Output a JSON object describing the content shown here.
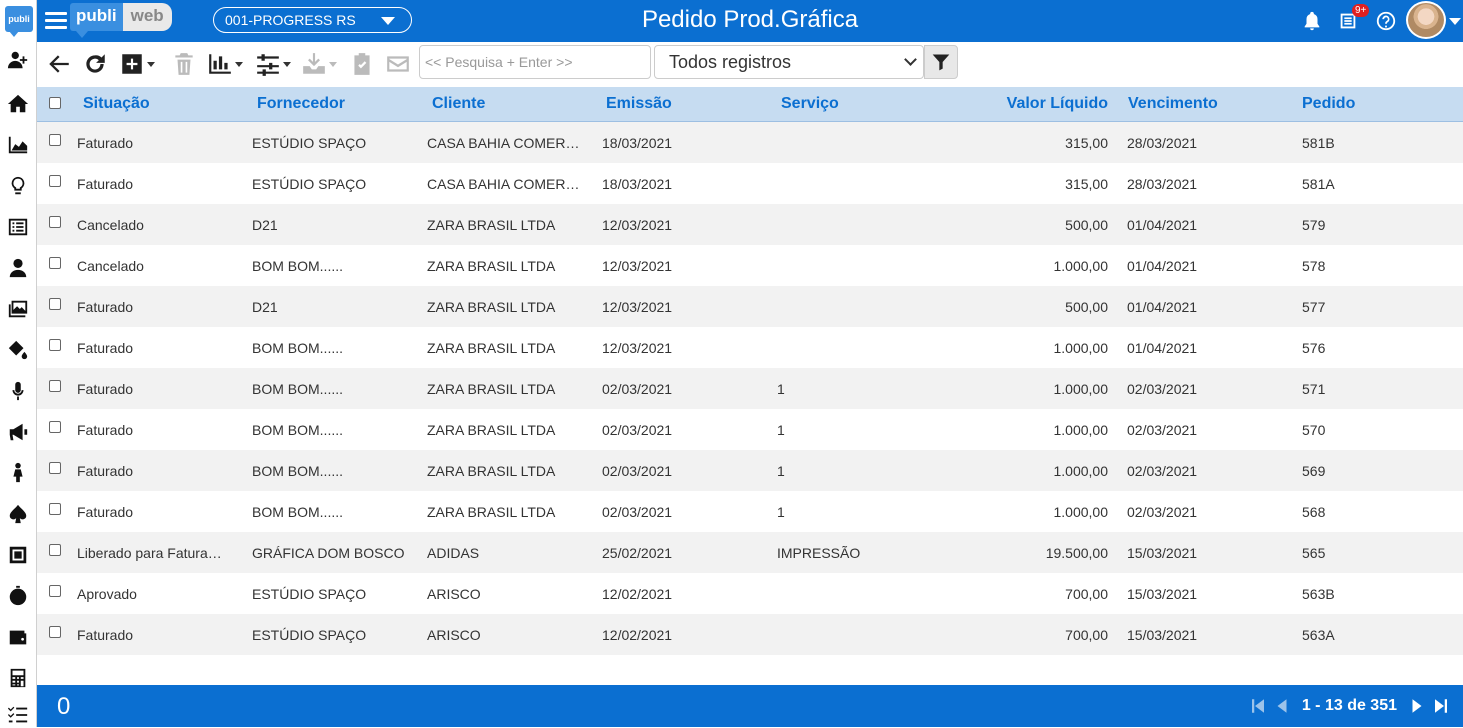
{
  "app": {
    "logo": "publi",
    "brand_part1": "publi",
    "brand_part2": "web",
    "company": "001-PROGRESS RS",
    "page_title": "Pedido Prod.Gráfica",
    "notification_badge": "9+"
  },
  "sidebar": {
    "items": [
      {
        "icon": "add-user-icon"
      },
      {
        "icon": "home-icon"
      },
      {
        "icon": "area-chart-icon"
      },
      {
        "icon": "lightbulb-icon"
      },
      {
        "icon": "list-icon"
      },
      {
        "icon": "user-tie-icon"
      },
      {
        "icon": "photo-icon"
      },
      {
        "icon": "paint-bucket-icon"
      },
      {
        "icon": "microphone-icon"
      },
      {
        "icon": "megaphone-icon"
      },
      {
        "icon": "person-icon"
      },
      {
        "icon": "spade-icon"
      },
      {
        "icon": "square-icon"
      },
      {
        "icon": "stopwatch-icon"
      },
      {
        "icon": "wallet-icon"
      },
      {
        "icon": "calculator-icon"
      },
      {
        "icon": "tasks-icon"
      }
    ]
  },
  "toolbar": {
    "search_placeholder": "<< Pesquisa + Enter >>",
    "records_filter": "Todos registros"
  },
  "table": {
    "columns": [
      "Situação",
      "Fornecedor",
      "Cliente",
      "Emissão",
      "Serviço",
      "Valor Líquido",
      "Vencimento",
      "Pedido"
    ],
    "rows": [
      {
        "situacao": "Faturado",
        "fornecedor": "ESTÚDIO SPAÇO",
        "cliente": "CASA BAHIA COMER…",
        "emissao": "18/03/2021",
        "servico": "",
        "valor": "315,00",
        "vencimento": "28/03/2021",
        "pedido": "581B"
      },
      {
        "situacao": "Faturado",
        "fornecedor": "ESTÚDIO SPAÇO",
        "cliente": "CASA BAHIA COMER…",
        "emissao": "18/03/2021",
        "servico": "",
        "valor": "315,00",
        "vencimento": "28/03/2021",
        "pedido": "581A"
      },
      {
        "situacao": "Cancelado",
        "fornecedor": "D21",
        "cliente": "ZARA BRASIL LTDA",
        "emissao": "12/03/2021",
        "servico": "",
        "valor": "500,00",
        "vencimento": "01/04/2021",
        "pedido": "579"
      },
      {
        "situacao": "Cancelado",
        "fornecedor": "BOM BOM......",
        "cliente": "ZARA BRASIL LTDA",
        "emissao": "12/03/2021",
        "servico": "",
        "valor": "1.000,00",
        "vencimento": "01/04/2021",
        "pedido": "578"
      },
      {
        "situacao": "Faturado",
        "fornecedor": "D21",
        "cliente": "ZARA BRASIL LTDA",
        "emissao": "12/03/2021",
        "servico": "",
        "valor": "500,00",
        "vencimento": "01/04/2021",
        "pedido": "577"
      },
      {
        "situacao": "Faturado",
        "fornecedor": "BOM BOM......",
        "cliente": "ZARA BRASIL LTDA",
        "emissao": "12/03/2021",
        "servico": "",
        "valor": "1.000,00",
        "vencimento": "01/04/2021",
        "pedido": "576"
      },
      {
        "situacao": "Faturado",
        "fornecedor": "BOM BOM......",
        "cliente": "ZARA BRASIL LTDA",
        "emissao": "02/03/2021",
        "servico": "1",
        "valor": "1.000,00",
        "vencimento": "02/03/2021",
        "pedido": "571"
      },
      {
        "situacao": "Faturado",
        "fornecedor": "BOM BOM......",
        "cliente": "ZARA BRASIL LTDA",
        "emissao": "02/03/2021",
        "servico": "1",
        "valor": "1.000,00",
        "vencimento": "02/03/2021",
        "pedido": "570"
      },
      {
        "situacao": "Faturado",
        "fornecedor": "BOM BOM......",
        "cliente": "ZARA BRASIL LTDA",
        "emissao": "02/03/2021",
        "servico": "1",
        "valor": "1.000,00",
        "vencimento": "02/03/2021",
        "pedido": "569"
      },
      {
        "situacao": "Faturado",
        "fornecedor": "BOM BOM......",
        "cliente": "ZARA BRASIL LTDA",
        "emissao": "02/03/2021",
        "servico": "1",
        "valor": "1.000,00",
        "vencimento": "02/03/2021",
        "pedido": "568"
      },
      {
        "situacao": "Liberado para Fatura…",
        "fornecedor": "GRÁFICA DOM BOSCO",
        "cliente": "ADIDAS",
        "emissao": "25/02/2021",
        "servico": "IMPRESSÃO",
        "valor": "19.500,00",
        "vencimento": "15/03/2021",
        "pedido": "565"
      },
      {
        "situacao": "Aprovado",
        "fornecedor": "ESTÚDIO SPAÇO",
        "cliente": "ARISCO",
        "emissao": "12/02/2021",
        "servico": "",
        "valor": "700,00",
        "vencimento": "15/03/2021",
        "pedido": "563B"
      },
      {
        "situacao": "Faturado",
        "fornecedor": "ESTÚDIO SPAÇO",
        "cliente": "ARISCO",
        "emissao": "12/02/2021",
        "servico": "",
        "valor": "700,00",
        "vencimento": "15/03/2021",
        "pedido": "563A"
      }
    ]
  },
  "footer": {
    "selected_count": "0",
    "page_info": "1 - 13 de 351"
  },
  "colors": {
    "primary": "#0b6fd1",
    "header_bg": "#c6dcf1",
    "row_alt": "#f2f2f2"
  }
}
